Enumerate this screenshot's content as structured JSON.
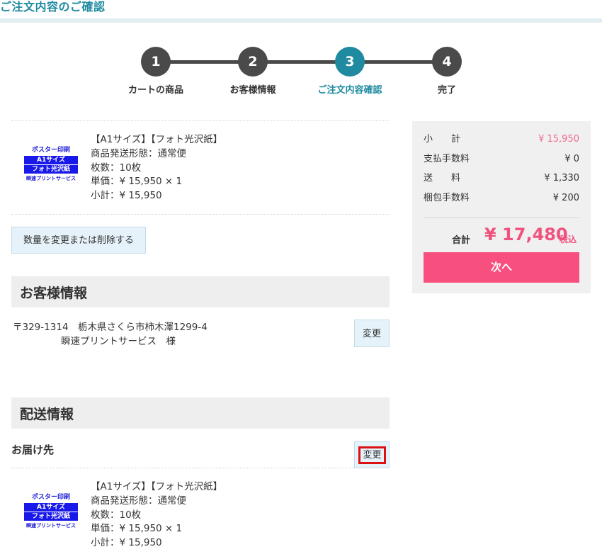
{
  "page_title": "ご注文内容のご確認",
  "steps": [
    {
      "number": "1",
      "label": "カートの商品"
    },
    {
      "number": "2",
      "label": "お客様情報"
    },
    {
      "number": "3",
      "label": "ご注文内容確認"
    },
    {
      "number": "4",
      "label": "完了"
    }
  ],
  "product_thumbnail": {
    "line1": "ポスター印刷",
    "line2": "A1サイズ",
    "line3": "フォト光沢紙",
    "line4": "瞬速プリントサービス"
  },
  "product": {
    "name": "【A1サイズ】【フォト光沢紙】",
    "shipping": "商品発送形態：通常便",
    "quantity": "枚数：10枚",
    "unit_price": "単価：¥ 15,950 × 1",
    "subtotal": "小計：¥ 15,950"
  },
  "change_quantity_button": "数量を変更または削除する",
  "customer_section": {
    "title": "お客様情報",
    "address": "〒329-1314　栃木県さくら市柿木澤1299-4",
    "name": "瞬速プリントサービス　様",
    "change_button": "変更"
  },
  "delivery_section": {
    "title": "配送情報",
    "destination_label": "お届け先",
    "change_button": "変更"
  },
  "summary": {
    "rows": [
      {
        "label": "小　　計",
        "value": "¥ 15,950"
      },
      {
        "label": "支払手数料",
        "value": "¥ 0"
      },
      {
        "label": "送　　料",
        "value": "¥ 1,330"
      },
      {
        "label": "梱包手数料",
        "value": "¥ 200"
      }
    ],
    "total_label": "合計",
    "total_value": "¥ 17,480",
    "tax_label": "税込",
    "next_button": "次へ"
  },
  "colors": {
    "accent": "#1f8aa0",
    "step_inactive": "#4a4a4a",
    "price_pink": "#f0527f",
    "next_button": "#f7507f",
    "highlight_border": "#dd1111"
  }
}
